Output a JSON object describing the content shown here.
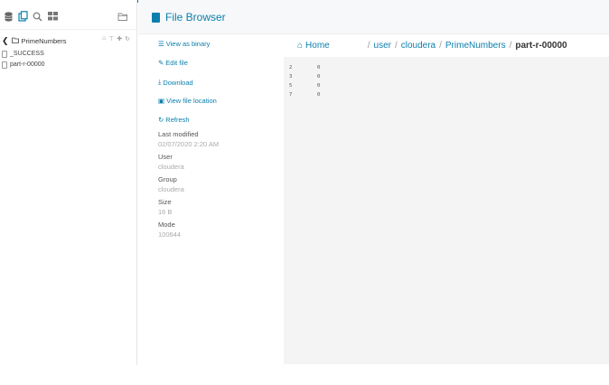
{
  "left_panel": {
    "path": "PrimeNumbers",
    "files": [
      {
        "name": "_SUCCESS"
      },
      {
        "name": "part-r-00000"
      }
    ]
  },
  "header": {
    "title": "File Browser"
  },
  "actions": {
    "view_as_binary": "View as binary",
    "edit_file": "Edit file",
    "download": "Download",
    "view_file_location": "View file location",
    "refresh": "Refresh"
  },
  "meta": {
    "last_modified_label": "Last modified",
    "last_modified_value": "02/07/2020 2:20 AM",
    "user_label": "User",
    "user_value": "cloudera",
    "group_label": "Group",
    "group_value": "cloudera",
    "size_label": "Size",
    "size_value": "16 B",
    "mode_label": "Mode",
    "mode_value": "100644"
  },
  "breadcrumb": {
    "home": "Home",
    "items": [
      "user",
      "cloudera",
      "PrimeNumbers"
    ],
    "current": "part-r-00000"
  },
  "file_content": [
    {
      "key": "2",
      "value": "0"
    },
    {
      "key": "3",
      "value": "0"
    },
    {
      "key": "5",
      "value": "0"
    },
    {
      "key": "7",
      "value": "0"
    }
  ],
  "colors": {
    "accent": "#0b7fad"
  },
  "icons": {
    "toolbar": [
      "database-icon",
      "files-icon",
      "search-icon",
      "grid-icon",
      "folder-open-icon"
    ],
    "path_actions": [
      "home-icon",
      "filter-icon",
      "plus-icon",
      "refresh-icon"
    ]
  }
}
